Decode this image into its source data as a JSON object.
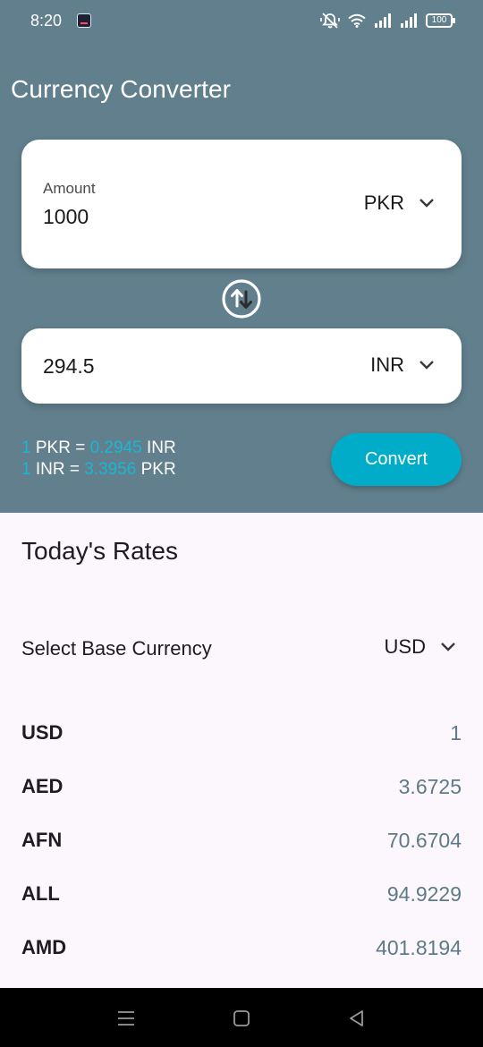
{
  "status_bar": {
    "time": "8:20",
    "battery": "100",
    "icons": [
      "app-notification-icon",
      "mute-icon",
      "wifi-icon",
      "signal-icon",
      "signal-icon",
      "battery-icon"
    ]
  },
  "app": {
    "title": "Currency Converter"
  },
  "converter": {
    "amount_label": "Amount",
    "amount_value": "1000",
    "from_currency": "PKR",
    "result_value": "294.5",
    "to_currency": "INR",
    "rate_line_1": {
      "one": "1",
      "from": " PKR = ",
      "rate": "0.2945",
      "to": " INR"
    },
    "rate_line_2": {
      "one": "1",
      "from": " INR = ",
      "rate": "3.3956",
      "to": " PKR"
    },
    "convert_label": "Convert"
  },
  "todays_rates": {
    "title": "Today's Rates",
    "base_label": "Select Base Currency",
    "base_currency": "USD",
    "rows": [
      {
        "code": "USD",
        "value": "1"
      },
      {
        "code": "AED",
        "value": "3.6725"
      },
      {
        "code": "AFN",
        "value": "70.6704"
      },
      {
        "code": "ALL",
        "value": "94.9229"
      },
      {
        "code": "AMD",
        "value": "401.8194"
      }
    ]
  },
  "colors": {
    "header_bg": "#617f8c",
    "accent": "#00acc8",
    "rate_number": "#19b7d4",
    "list_value": "#5d7a86",
    "page_bg": "#fcf7fc"
  }
}
